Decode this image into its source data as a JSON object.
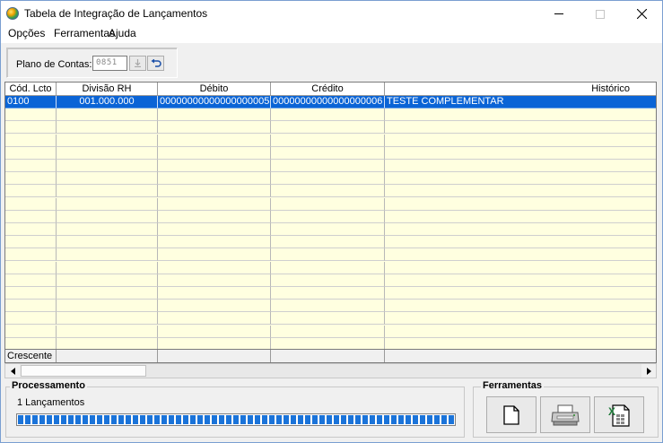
{
  "window": {
    "title": "Tabela de Integração de Lançamentos",
    "controls": {
      "minimize": "minimize",
      "maximize": "maximize",
      "close": "✕"
    }
  },
  "menu": [
    "Opções",
    "Ferramentas",
    "Ajuda"
  ],
  "plano": {
    "label": "Plano de Contas:",
    "value": "0851",
    "download_icon": "download-icon",
    "undo_icon": "undo-icon"
  },
  "grid": {
    "columns": [
      "Cód. Lcto",
      "Divisão RH",
      "Débito",
      "Crédito",
      "Histórico"
    ],
    "rows": [
      {
        "cod": "0100",
        "divisao": "001.000.000",
        "debito": "00000000000000000005",
        "credito": "00000000000000000006",
        "historico": "TESTE COMPLEMENTAR",
        "selected": true
      }
    ],
    "footer": [
      "Crescente",
      "",
      "",
      "",
      ""
    ]
  },
  "processamento": {
    "title": "Processamento",
    "count_text": "1 Lançamentos",
    "progress": 1.0,
    "accent": "#1a73d9"
  },
  "ferramentas": {
    "title": "Ferramentas",
    "buttons": [
      "new-document-icon",
      "printer-icon",
      "excel-export-icon"
    ]
  },
  "colors": {
    "grid_bg": "#ffffe0",
    "selection": "#0a64d6"
  }
}
